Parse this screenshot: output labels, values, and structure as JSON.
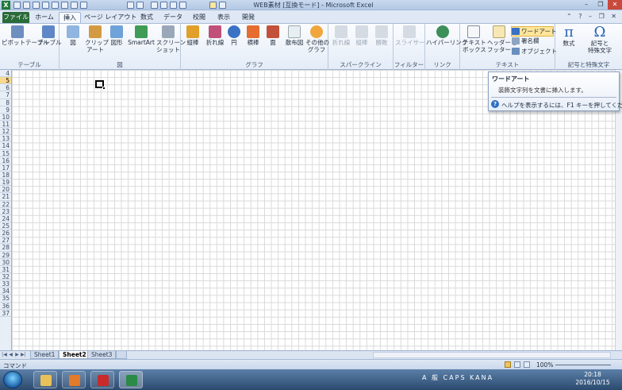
{
  "window": {
    "title": "WEB素材 [互換モード] - Microsoft Excel",
    "app_icon": "X"
  },
  "tabs": [
    "ファイル",
    "ホーム",
    "挿入",
    "ページ レイアウト",
    "数式",
    "データ",
    "校閲",
    "表示",
    "開発"
  ],
  "ribbon": {
    "groups": {
      "table": "テーブル",
      "illust": "図",
      "graph": "グラフ",
      "spark": "スパークライン",
      "filter": "フィルター",
      "link": "リンク",
      "text": "テキスト",
      "symbols": "記号と特殊文字"
    },
    "buttons": {
      "pivot": "ピボットテーブル",
      "table": "テーブル",
      "picture": "図",
      "clipart1": "クリップ",
      "clipart2": "アート",
      "shapes": "図形",
      "smartart": "SmartArt",
      "screenshot1": "スクリーン",
      "screenshot2": "ショット",
      "column": "縦棒",
      "line": "折れ線",
      "pie": "円",
      "bar": "横棒",
      "area": "面",
      "scatter": "散布図",
      "other1": "その他の",
      "other2": "グラフ",
      "sp_line": "折れ線",
      "sp_column": "縦棒",
      "sp_winloss": "勝敗",
      "slicer": "スライサー",
      "hyperlink": "ハイパーリンク",
      "textbox1": "テキスト",
      "textbox2": "ボックス",
      "header1": "ヘッダーと",
      "header2": "フッター",
      "wordart": "ワードアート",
      "signature": "署名欄",
      "object": "オブジェクト",
      "equation": "数式",
      "symbol1": "記号と",
      "symbol2": "特殊文字"
    }
  },
  "rows": [
    "4",
    "5",
    "6",
    "7",
    "8",
    "9",
    "10",
    "11",
    "12",
    "13",
    "14",
    "15",
    "16",
    "17",
    "18",
    "19",
    "20",
    "21",
    "22",
    "23",
    "24",
    "25",
    "26",
    "27",
    "28",
    "29",
    "30",
    "31",
    "32",
    "33",
    "34",
    "35",
    "36",
    "37"
  ],
  "selected_row": "5",
  "tooltip": {
    "title": "ワードアート",
    "description": "装飾文字列を文書に挿入します。",
    "help": "ヘルプを表示するには、F1 キーを押してください。"
  },
  "sheets": [
    "Sheet1",
    "Sheet2",
    "Sheet3"
  ],
  "active_sheet": "Sheet2",
  "status": {
    "mode": "コマンド",
    "zoom": "100%"
  },
  "taskbar": {
    "time": "20:18",
    "date": "2016/10/15",
    "tray": "A 般 CAPS KANA"
  },
  "colors": {
    "file_tab": "#2a6b3a",
    "accent": "#2d6fc6"
  }
}
